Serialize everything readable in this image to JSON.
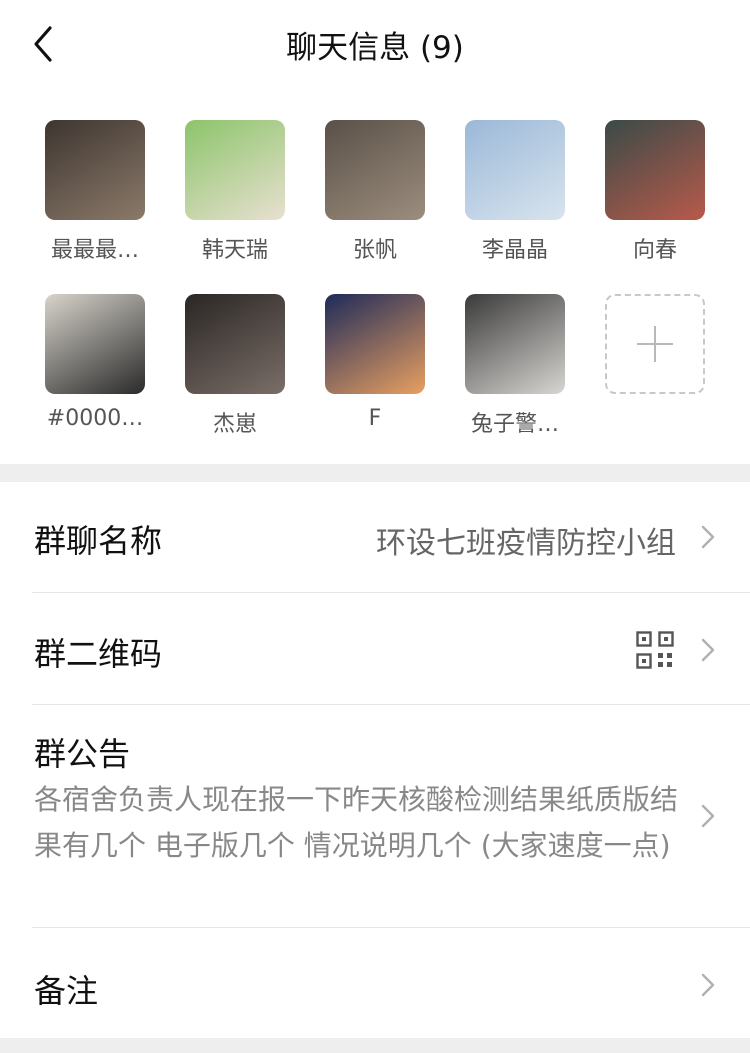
{
  "header": {
    "title": "聊天信息 (9)"
  },
  "members": [
    {
      "name": "最最最…",
      "avatar": [
        "#3d3530",
        "#8c7a6a"
      ]
    },
    {
      "name": "韩天瑞",
      "avatar": [
        "#8cc46a",
        "#e8e0d0"
      ]
    },
    {
      "name": "张帆",
      "avatar": [
        "#5a5048",
        "#9c8e7e"
      ]
    },
    {
      "name": "李晶晶",
      "avatar": [
        "#9bb8d8",
        "#d8e4ee"
      ]
    },
    {
      "name": "向春",
      "avatar": [
        "#3a4a48",
        "#b85a4a"
      ]
    },
    {
      "name": "#0000…",
      "avatar": [
        "#d8d4cc",
        "#2a2a2a"
      ]
    },
    {
      "name": "杰崽",
      "avatar": [
        "#2a2624",
        "#7a6e68"
      ]
    },
    {
      "name": "F",
      "avatar": [
        "#1e2a5a",
        "#e8a060"
      ]
    },
    {
      "name": "兔子警…",
      "avatar": [
        "#3a3a3a",
        "#d8d6d2"
      ]
    }
  ],
  "add_member_icon": "plus-icon",
  "settings": {
    "group_name_label": "群聊名称",
    "group_name_value": "环设七班疫情防控小组",
    "qr_label": "群二维码",
    "qr_icon": "qr-code-icon",
    "notice_label": "群公告",
    "notice_text": "各宿舍负责人现在报一下昨天核酸检测结果纸质版结果有几个 电子版几个 情况说明几个 (大家速度一点)",
    "remark_label": "备注"
  }
}
